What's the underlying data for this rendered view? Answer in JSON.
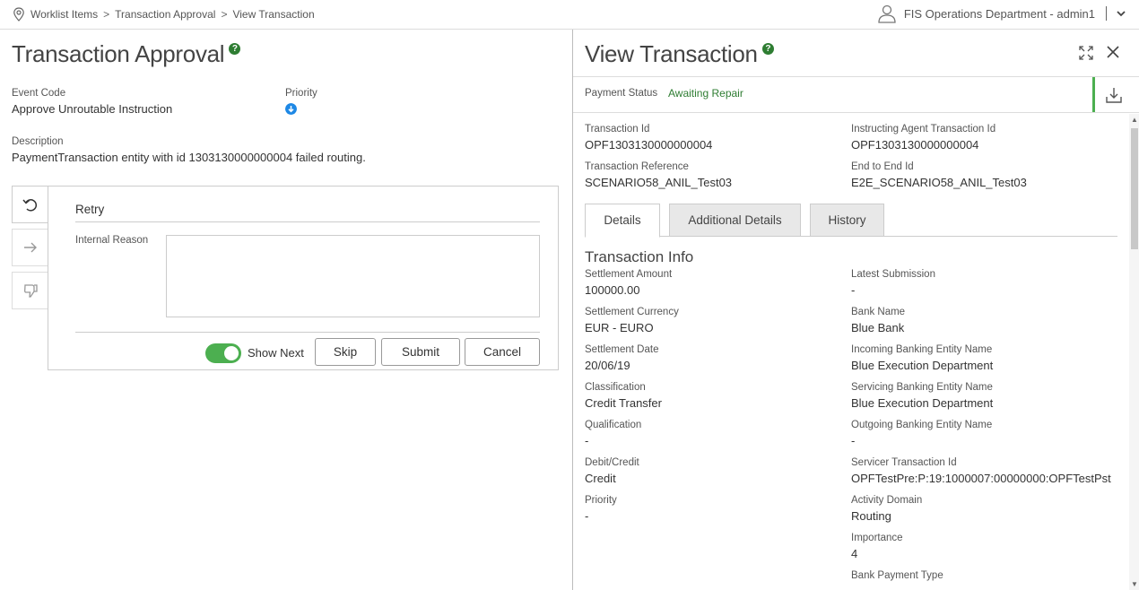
{
  "breadcrumb": {
    "items": [
      "Worklist Items",
      "Transaction Approval",
      "View Transaction"
    ],
    "separator": ">"
  },
  "user": {
    "label": "FIS Operations Department - admin1"
  },
  "left": {
    "title": "Transaction Approval",
    "help": "?",
    "event_code_label": "Event Code",
    "event_code_value": "Approve Unroutable Instruction",
    "priority_label": "Priority",
    "description_label": "Description",
    "description_value": "PaymentTransaction entity with id 1303130000000004 failed routing.",
    "action_panel": {
      "heading": "Retry",
      "internal_reason_label": "Internal Reason",
      "show_next_label": "Show Next",
      "show_next_on": true,
      "skip_label": "Skip",
      "submit_label": "Submit",
      "cancel_label": "Cancel"
    }
  },
  "right": {
    "title": "View Transaction",
    "help": "?",
    "payment_status_label": "Payment Status",
    "payment_status_value": "Awaiting Repair",
    "header_fields": [
      {
        "label": "Transaction Id",
        "value": "OPF1303130000000004"
      },
      {
        "label": "Instructing Agent Transaction Id",
        "value": "OPF1303130000000004"
      },
      {
        "label": "Transaction Reference",
        "value": "SCENARIO58_ANIL_Test03"
      },
      {
        "label": "End to End Id",
        "value": "E2E_SCENARIO58_ANIL_Test03"
      }
    ],
    "tabs": [
      "Details",
      "Additional Details",
      "History"
    ],
    "section_title": "Transaction Info",
    "left_fields": [
      {
        "label": "Settlement Amount",
        "value": "100000.00"
      },
      {
        "label": "Settlement Currency",
        "value": "EUR - EURO"
      },
      {
        "label": "Settlement Date",
        "value": "20/06/19"
      },
      {
        "label": "Classification",
        "value": "Credit Transfer"
      },
      {
        "label": "Qualification",
        "value": "-"
      },
      {
        "label": "Debit/Credit",
        "value": "Credit"
      },
      {
        "label": "Priority",
        "value": "-"
      }
    ],
    "right_fields": [
      {
        "label": "Latest Submission",
        "value": "-"
      },
      {
        "label": "Bank Name",
        "value": "Blue Bank"
      },
      {
        "label": "Incoming Banking Entity Name",
        "value": "Blue Execution Department"
      },
      {
        "label": "Servicing Banking Entity Name",
        "value": "Blue Execution Department"
      },
      {
        "label": "Outgoing Banking Entity Name",
        "value": "-"
      },
      {
        "label": "Servicer Transaction Id",
        "value": "OPFTestPre:P:19:1000007:00000000:OPFTestPst"
      },
      {
        "label": "Activity Domain",
        "value": "Routing"
      },
      {
        "label": "Importance",
        "value": "4"
      },
      {
        "label": "Bank Payment Type",
        "value": ""
      }
    ]
  },
  "colors": {
    "accent_green": "#4caf50",
    "help_green": "#2e7d32",
    "priority_blue": "#1e88e5"
  }
}
